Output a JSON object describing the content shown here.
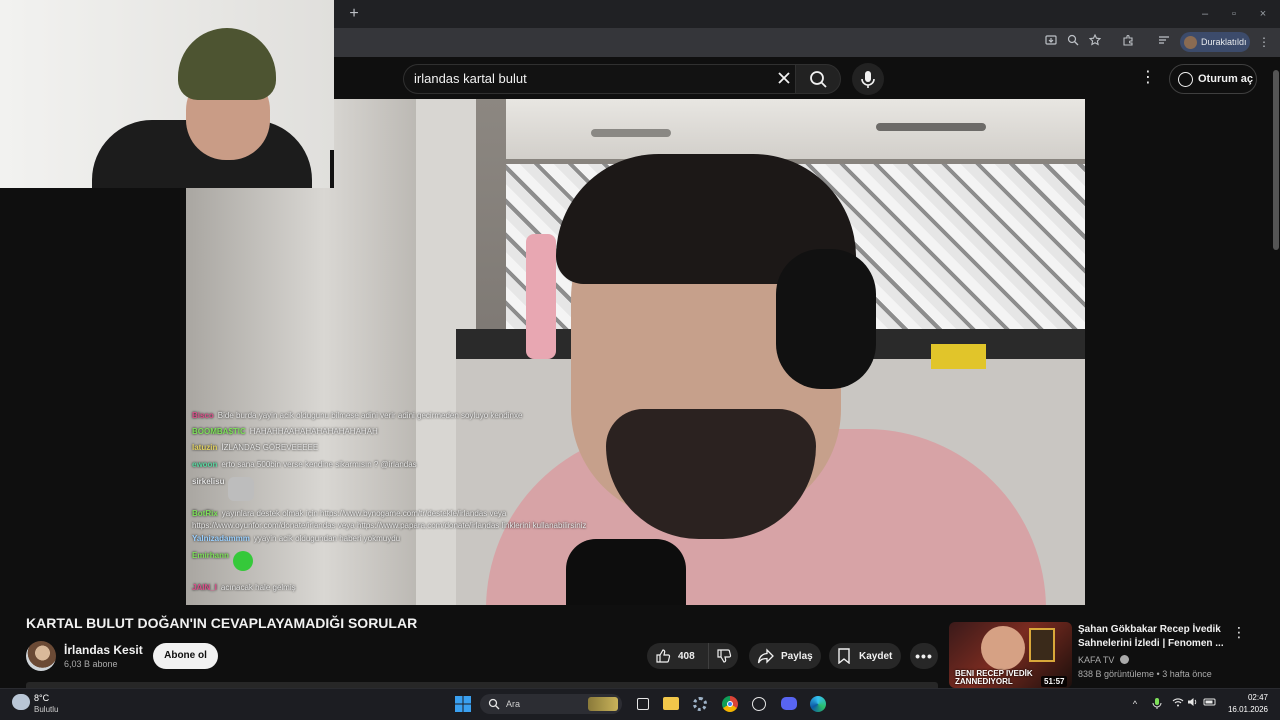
{
  "browser": {
    "new_tab": "+",
    "profile_label": "Duraklatıldı",
    "window_controls": {
      "minimize": "–",
      "maximize": "▫",
      "close": "×"
    }
  },
  "masthead": {
    "search_query": "irlandas kartal bulut",
    "sign_in_label": "Oturum aç"
  },
  "chat": [
    {
      "user": "Bisco",
      "user_color": "#d94f8a",
      "text": "Bide burda yayin acik oldugunu bilmese adini verir adini gecirmeden soyluyo kendinxe"
    },
    {
      "user": "BOOMBA$TIC",
      "user_color": "#7ee05a",
      "text": "HAHAHHAAHAHAHAHAHAHAHAH"
    },
    {
      "user": "latuzin",
      "user_color": "#e0d060",
      "text": "İZLANDAS GÖREVEEEEE"
    },
    {
      "user": "ewoon",
      "user_color": "#5ad6a0",
      "text": "erto sana 500bin verse kendine sikarmısın ? @irlandas"
    },
    {
      "user": "sirkelisu",
      "user_color": "#e6e6e6",
      "text": ""
    },
    {
      "user": "BotRix",
      "user_color": "#7ee05a",
      "text": "yayınlara destek olmak için https://www.bynogame.com/tr/destekle/irlandas veya"
    },
    {
      "user": "",
      "user_color": "#e6e6e6",
      "text": "https://www.oyunfor.com/donate/irlandas veya https://www.papara.com/donate/irlandas linklerini kullanabilirsiniz"
    },
    {
      "user": "Yalnizadammm",
      "user_color": "#9ad0ff",
      "text": "yyayin acik oldugundan haberi yokmuydu"
    },
    {
      "user": "Emirhann",
      "user_color": "#7ee05a",
      "text": ""
    },
    {
      "user": "JAIN_I",
      "user_color": "#d94f8a",
      "text": "acınacak hale gelmiş"
    }
  ],
  "video": {
    "title": "KARTAL BULUT DOĞAN'IN CEVAPLAYAMADIĞI SORULAR",
    "channel": "İrlandas Kesit",
    "subscribers": "6,03 B abone",
    "subscribe_label": "Abone ol",
    "likes": "408",
    "share_label": "Paylaş",
    "save_label": "Kaydet"
  },
  "recommended": {
    "title": "Şahan Gökbakar Recep İvedik Sahnelerini İzledi | Fenomen ...",
    "channel": "KAFA TV",
    "meta": "838 B görüntüleme • 3 hafta önce",
    "duration": "51:57",
    "thumb_text": "BENI RECEP IVEDİK ZANNEDIYORL"
  },
  "taskbar": {
    "temperature": "8°C",
    "weather": "Bulutlu",
    "search_label": "Ara",
    "time": "02:47",
    "date": "16.01.2026"
  }
}
